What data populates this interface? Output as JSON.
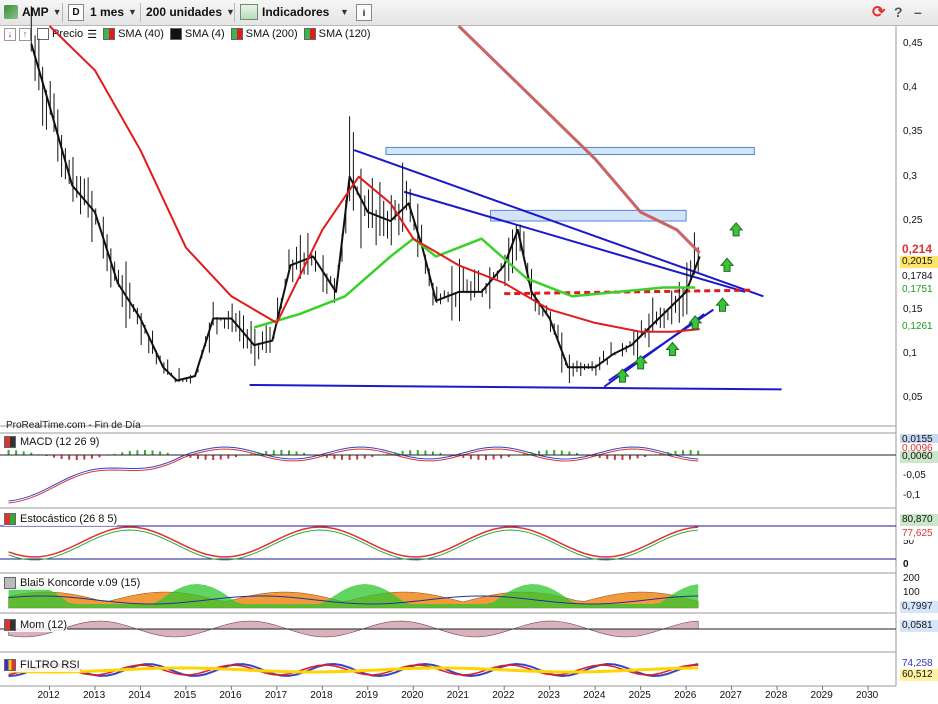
{
  "toolbar": {
    "symbol": "AMP",
    "type_button": "D",
    "period": "1 mes",
    "units": "200 unidades",
    "indicators": "Indicadores"
  },
  "legend": [
    {
      "label": "Precio",
      "color": "#ffffff"
    },
    {
      "label": "SMA (40)",
      "color": "#39b54a"
    },
    {
      "label": "SMA (4)",
      "color": "#111111"
    },
    {
      "label": "SMA (200)",
      "color": "#d9534f"
    },
    {
      "label": "SMA (120)",
      "color": "#e02020"
    }
  ],
  "watermark": "ProRealTime.com - Fin de Día",
  "panels": {
    "macd": {
      "label": "MACD (12 26 9)",
      "ticks": [
        "0",
        "-0,05",
        "-0,1"
      ],
      "tags": [
        "0,0155",
        "0,0096",
        "0,0060"
      ]
    },
    "stoch": {
      "label": "Estocástico (26 8 5)",
      "ticks": [
        "50",
        "0"
      ],
      "tags": [
        "80,870",
        "77,625"
      ]
    },
    "koncorde": {
      "label": "Blai5 Koncorde v.09 (15)",
      "ticks": [
        "200",
        "100"
      ],
      "tags": [
        "0,7997"
      ]
    },
    "mom": {
      "label": "Mom (12)",
      "tags": [
        "0,0581"
      ]
    },
    "rsi": {
      "label": "FILTRO RSI",
      "tags": [
        "74,258",
        "60,512"
      ]
    }
  },
  "price_tags": {
    "last": "0,214",
    "close": "0,2015",
    "sma4": "0,1784",
    "sma40": "0,1751",
    "sma120": "0,1261"
  },
  "colors": {
    "sma40": "#39d12a",
    "sma4": "#111111",
    "sma200": "#c86464",
    "sma120": "#e11b1b",
    "trend": "#1a1acc",
    "zone": "#cfe2f7"
  },
  "chart_data": {
    "type": "line",
    "title": "AMP",
    "xlabel": "",
    "ylabel": "",
    "x_ticks": [
      "2012",
      "2013",
      "2014",
      "2015",
      "2016",
      "2017",
      "2018",
      "2019",
      "2020",
      "2021",
      "2022",
      "2023",
      "2024",
      "2025",
      "2026",
      "2027",
      "2028",
      "2029",
      "2030"
    ],
    "y_ticks": [
      "0,45",
      "0,4",
      "0,35",
      "0,3",
      "0,25",
      "0,2",
      "0,15",
      "0,1",
      "0,05"
    ],
    "ylim": [
      0.03,
      0.47
    ],
    "series": [
      {
        "name": "SMA (4)",
        "x": [
          2011.6,
          2012.0,
          2012.5,
          2013.0,
          2013.5,
          2014.0,
          2014.5,
          2014.8,
          2015.2,
          2015.6,
          2016.0,
          2016.5,
          2016.9,
          2017.3,
          2017.8,
          2018.3,
          2018.6,
          2019.0,
          2019.5,
          2019.9,
          2020.2,
          2020.5,
          2021.0,
          2021.5,
          2022.0,
          2022.3,
          2022.6,
          2023.0,
          2023.4,
          2024.0,
          2024.4,
          2024.8,
          2025.2,
          2025.6,
          2026.0,
          2026.3
        ],
        "y": [
          0.45,
          0.38,
          0.29,
          0.26,
          0.18,
          0.14,
          0.085,
          0.07,
          0.075,
          0.14,
          0.14,
          0.11,
          0.115,
          0.2,
          0.21,
          0.17,
          0.3,
          0.26,
          0.25,
          0.27,
          0.22,
          0.16,
          0.17,
          0.17,
          0.2,
          0.24,
          0.17,
          0.14,
          0.085,
          0.085,
          0.1,
          0.11,
          0.13,
          0.15,
          0.17,
          0.21
        ]
      },
      {
        "name": "SMA (40)",
        "x": [
          2016.5,
          2017.5,
          2018.5,
          2019.5,
          2020.0,
          2020.5,
          2021.5,
          2022.5,
          2023.5,
          2024.5,
          2025.5,
          2026.2
        ],
        "y": [
          0.13,
          0.145,
          0.165,
          0.21,
          0.23,
          0.21,
          0.23,
          0.185,
          0.165,
          0.17,
          0.175,
          0.175
        ]
      },
      {
        "name": "SMA (120)",
        "x": [
          2012.0,
          2013.0,
          2014.0,
          2015.0,
          2016.0,
          2017.0,
          2018.0,
          2018.8,
          2019.5,
          2020.0,
          2021.0,
          2022.0,
          2023.0,
          2024.0,
          2025.0,
          2025.7,
          2026.3
        ],
        "y": [
          0.47,
          0.42,
          0.33,
          0.22,
          0.165,
          0.135,
          0.24,
          0.3,
          0.27,
          0.23,
          0.2,
          0.18,
          0.15,
          0.135,
          0.125,
          0.125,
          0.128
        ]
      },
      {
        "name": "SMA (200)",
        "x": [
          2021.0,
          2022.0,
          2023.0,
          2024.0,
          2025.0,
          2025.8,
          2026.3
        ],
        "y": [
          0.47,
          0.42,
          0.37,
          0.32,
          0.26,
          0.24,
          0.214
        ]
      }
    ],
    "trendlines": [
      {
        "x": [
          2018.7,
          2027.7
        ],
        "y": [
          0.33,
          0.165
        ]
      },
      {
        "x": [
          2019.8,
          2027.3
        ],
        "y": [
          0.283,
          0.17
        ]
      },
      {
        "x": [
          2016.4,
          2028.1
        ],
        "y": [
          0.065,
          0.06
        ]
      },
      {
        "x": [
          2024.2,
          2026.4
        ],
        "y": [
          0.063,
          0.145
        ]
      },
      {
        "x": [
          2024.3,
          2026.6
        ],
        "y": [
          0.07,
          0.15
        ]
      }
    ],
    "support_line": {
      "x": [
        2022.0,
        2027.5
      ],
      "y": [
        0.168,
        0.172
      ]
    },
    "zones": [
      {
        "x": [
          2019.4,
          2027.5
        ],
        "y": [
          0.325,
          0.333
        ]
      },
      {
        "x": [
          2021.7,
          2026.0
        ],
        "y": [
          0.25,
          0.262
        ]
      }
    ],
    "arrows": [
      {
        "x": 2024.6,
        "y": 0.075
      },
      {
        "x": 2025.0,
        "y": 0.09
      },
      {
        "x": 2025.7,
        "y": 0.105
      },
      {
        "x": 2026.2,
        "y": 0.135
      },
      {
        "x": 2026.8,
        "y": 0.155
      },
      {
        "x": 2026.9,
        "y": 0.2
      },
      {
        "x": 2027.1,
        "y": 0.24
      }
    ],
    "grid": false
  }
}
